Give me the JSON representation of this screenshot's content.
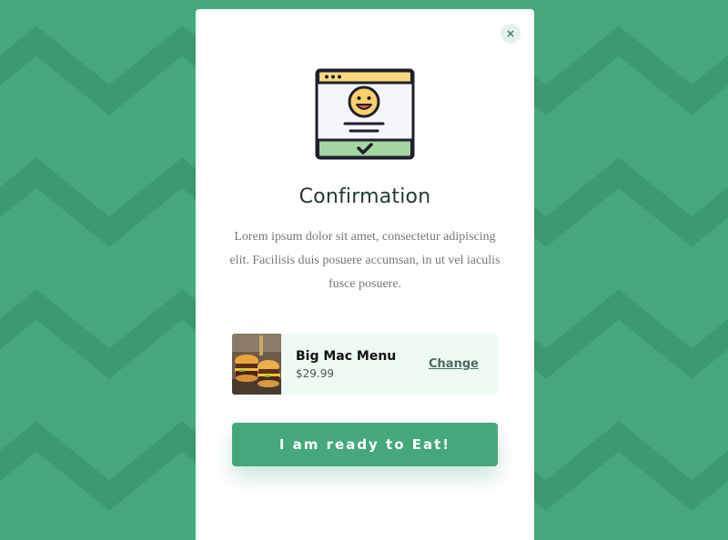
{
  "colors": {
    "background": "#45a87b",
    "pattern": "#3d9a70",
    "card_bg": "#ffffff",
    "accent": "#45a87b",
    "product_bg": "#eefbf3",
    "close_bg": "#e6f1ec"
  },
  "modal": {
    "close_icon": "close-icon",
    "close_glyph": "×",
    "illustration_icon": "browser-smiley-confirmation-icon",
    "title": "Confirmation",
    "description": "Lorem ipsum dolor sit amet, consectetur adipiscing elit. Facilisis duis posuere accumsan, in ut vel iaculis fusce posuere."
  },
  "product": {
    "image_icon": "burger-image",
    "name": "Big Mac Menu",
    "price": "$29.99",
    "change_label": "Change"
  },
  "cta": {
    "label": "I am ready to Eat!"
  }
}
